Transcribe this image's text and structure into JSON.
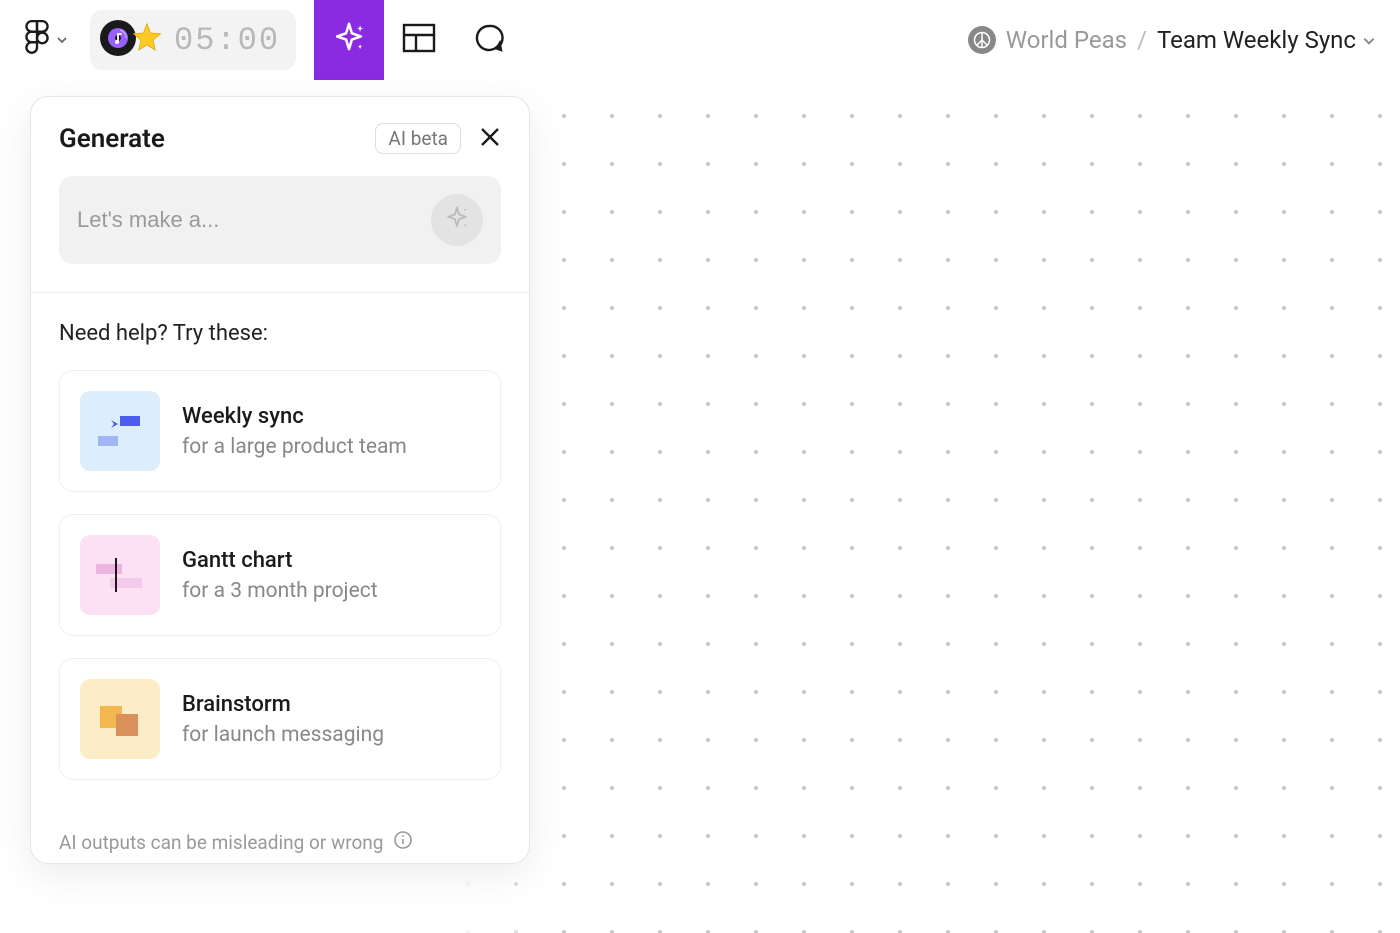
{
  "toolbar": {
    "timer": "05:00"
  },
  "breadcrumb": {
    "workspace": "World Peas",
    "separator": "/",
    "file": "Team Weekly Sync"
  },
  "panel": {
    "title": "Generate",
    "badge": "AI beta",
    "prompt_placeholder": "Let's make a...",
    "suggestions_heading": "Need help? Try these:",
    "suggestions": [
      {
        "title": "Weekly sync",
        "subtitle": "for a large product team"
      },
      {
        "title": "Gantt chart",
        "subtitle": "for a 3 month project"
      },
      {
        "title": "Brainstorm",
        "subtitle": "for launch messaging"
      }
    ],
    "disclaimer": "AI outputs can be misleading or wrong"
  }
}
